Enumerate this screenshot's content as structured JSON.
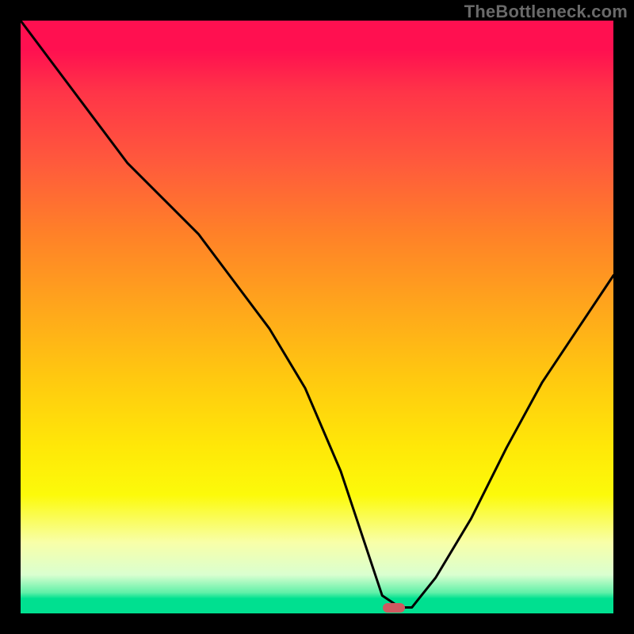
{
  "watermark": "TheBottleneck.com",
  "colors": {
    "background": "#000000",
    "curve": "#000000",
    "marker": "#cf5a60"
  },
  "chart_data": {
    "type": "line",
    "title": "",
    "xlabel": "",
    "ylabel": "",
    "xlim": [
      0,
      100
    ],
    "ylim": [
      0,
      100
    ],
    "grid": false,
    "legend": false,
    "series": [
      {
        "name": "bottleneck-curve",
        "x": [
          0,
          6,
          12,
          18,
          24,
          30,
          36,
          42,
          48,
          54,
          58,
          61,
          64,
          66,
          70,
          76,
          82,
          88,
          94,
          100
        ],
        "values": [
          100,
          92,
          84,
          76,
          70,
          64,
          56,
          48,
          38,
          24,
          12,
          3,
          1,
          1,
          6,
          16,
          28,
          39,
          48,
          57
        ]
      }
    ],
    "marker": {
      "x": 63,
      "y": 1
    }
  }
}
